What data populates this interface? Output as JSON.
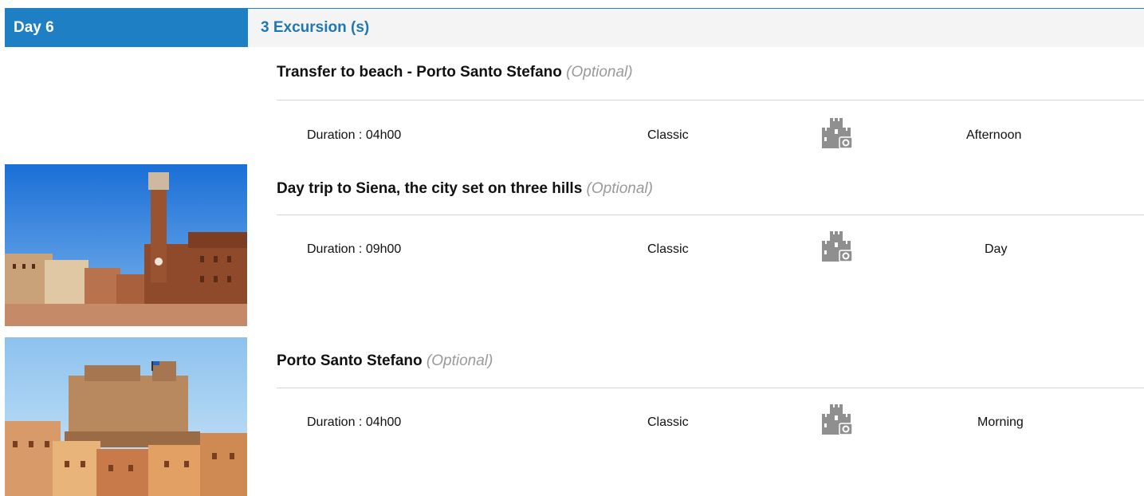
{
  "header": {
    "day_label": "Day 6",
    "excursion_count": "3 Excursion (s)"
  },
  "excursions": [
    {
      "title": "Transfer to beach - Porto Santo Stefano",
      "optional": "(Optional)",
      "duration": "Duration : 04h00",
      "category": "Classic",
      "icon": "castle-camera-icon",
      "time": "Afternoon"
    },
    {
      "title": "Day trip to Siena, the city set on three hills",
      "optional": "(Optional)",
      "duration": "Duration : 09h00",
      "category": "Classic",
      "icon": "castle-camera-icon",
      "time": "Day"
    },
    {
      "title": "Porto Santo Stefano",
      "optional": "(Optional)",
      "duration": "Duration : 04h00",
      "category": "Classic",
      "icon": "castle-camera-icon",
      "time": "Morning"
    }
  ],
  "colors": {
    "accent": "#1e7fc5",
    "optional_text": "#9a9a9a"
  }
}
